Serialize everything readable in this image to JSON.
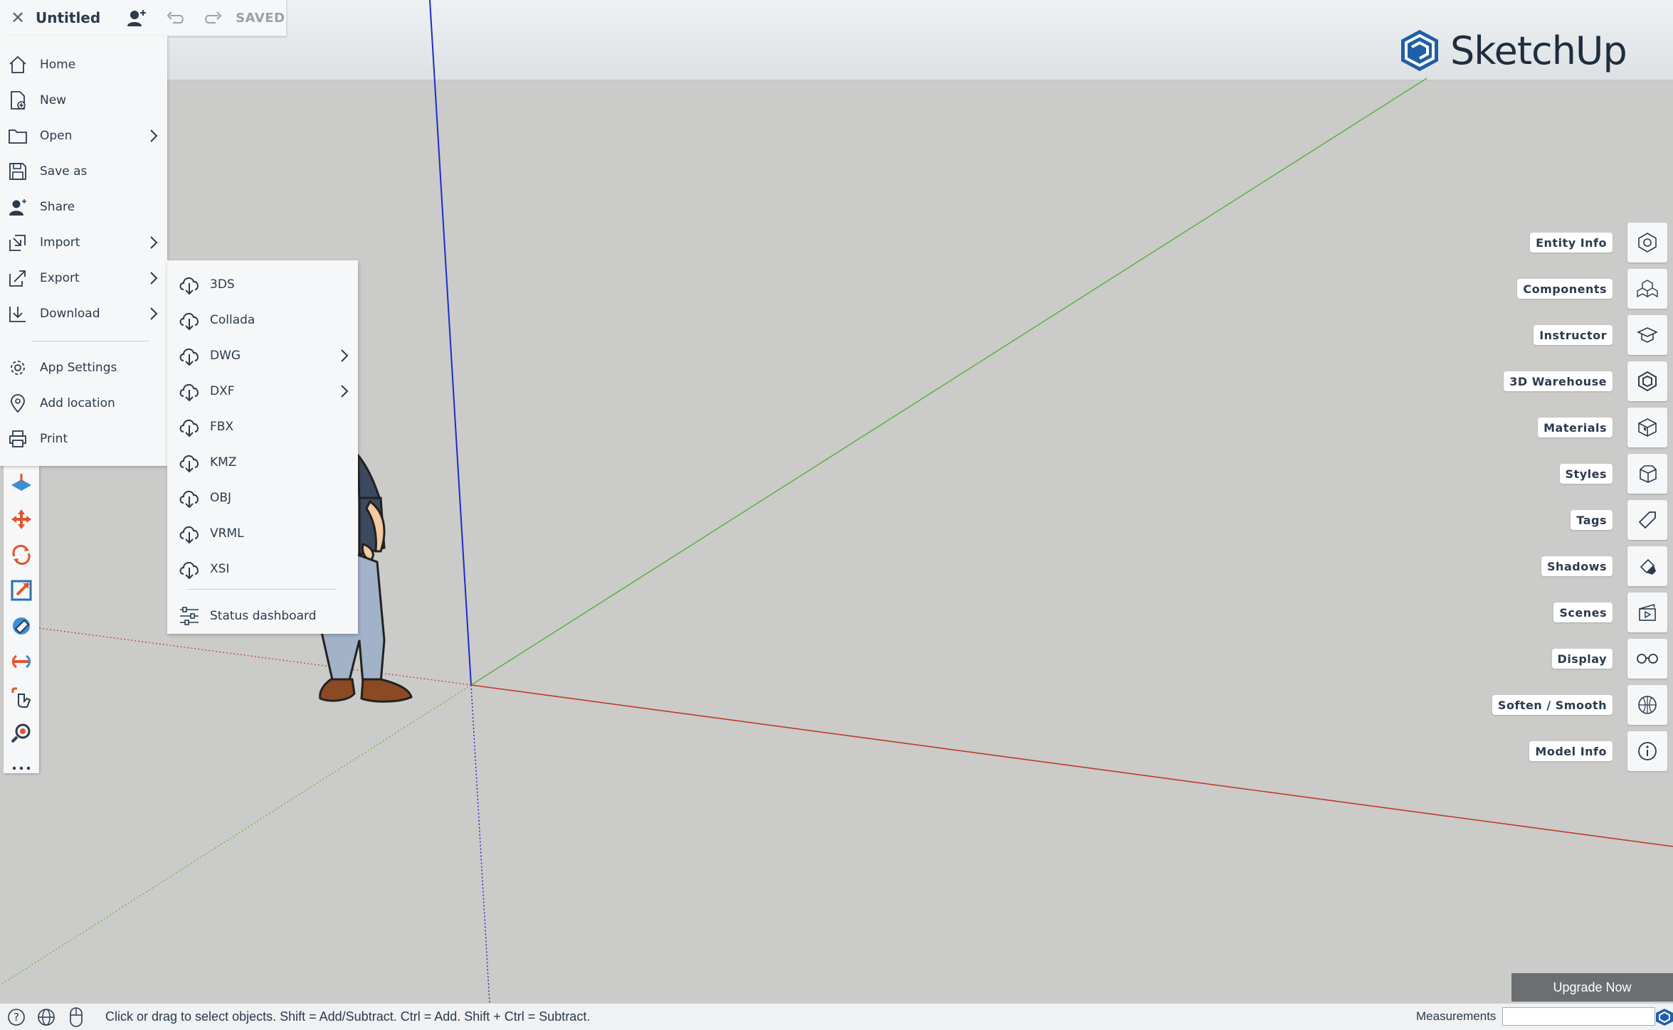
{
  "app": {
    "brand": "SketchUp",
    "doc_title": "Untitled",
    "save_state": "SAVED"
  },
  "menu": {
    "items": [
      {
        "label": "Home",
        "icon": "home-icon"
      },
      {
        "label": "New",
        "icon": "new-file-icon"
      },
      {
        "label": "Open",
        "icon": "folder-icon",
        "submenu": true
      },
      {
        "label": "Save as",
        "icon": "save-icon"
      },
      {
        "label": "Share",
        "icon": "share-user-icon"
      },
      {
        "label": "Import",
        "icon": "import-icon",
        "submenu": true
      },
      {
        "label": "Export",
        "icon": "export-icon",
        "submenu": true
      },
      {
        "label": "Download",
        "icon": "download-icon",
        "submenu": true
      },
      {
        "label": "App Settings",
        "icon": "gear-icon"
      },
      {
        "label": "Add location",
        "icon": "location-pin-icon"
      },
      {
        "label": "Print",
        "icon": "printer-icon"
      }
    ]
  },
  "export_menu": {
    "items": [
      {
        "label": "3DS"
      },
      {
        "label": "Collada"
      },
      {
        "label": "DWG",
        "submenu": true
      },
      {
        "label": "DXF",
        "submenu": true
      },
      {
        "label": "FBX"
      },
      {
        "label": "KMZ"
      },
      {
        "label": "OBJ"
      },
      {
        "label": "VRML"
      },
      {
        "label": "XSI"
      }
    ],
    "status": "Status dashboard"
  },
  "right_panel": {
    "items": [
      {
        "label": "Entity Info",
        "icon": "entity-info-icon"
      },
      {
        "label": "Components",
        "icon": "components-icon"
      },
      {
        "label": "Instructor",
        "icon": "instructor-icon"
      },
      {
        "label": "3D Warehouse",
        "icon": "warehouse-icon"
      },
      {
        "label": "Materials",
        "icon": "materials-icon"
      },
      {
        "label": "Styles",
        "icon": "styles-icon"
      },
      {
        "label": "Tags",
        "icon": "tag-icon"
      },
      {
        "label": "Shadows",
        "icon": "shadows-icon"
      },
      {
        "label": "Scenes",
        "icon": "scenes-icon"
      },
      {
        "label": "Display",
        "icon": "glasses-icon"
      },
      {
        "label": "Soften / Smooth",
        "icon": "soften-smooth-icon"
      },
      {
        "label": "Model Info",
        "icon": "info-icon"
      }
    ]
  },
  "upgrade": "Upgrade Now",
  "status": {
    "hint": "Click or drag to select objects. Shift = Add/Subtract. Ctrl = Add. Shift + Ctrl = Subtract.",
    "measurements_label": "Measurements",
    "measurements_value": ""
  },
  "colors": {
    "accent": "#2b3a4e",
    "tool_orange": "#e2542b",
    "tool_blue": "#3a8fd6",
    "axis_red": "#c0392b",
    "axis_green": "#5ab43a",
    "axis_blue": "#1b2ec8"
  }
}
